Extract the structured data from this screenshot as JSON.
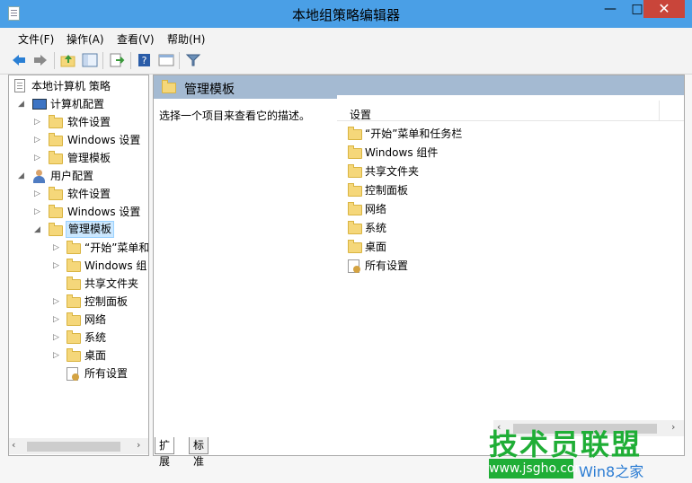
{
  "window": {
    "title": "本地组策略编辑器",
    "min_label": "—",
    "max_label": "□",
    "close_label": "✕"
  },
  "menu": [
    "文件(F)",
    "操作(A)",
    "查看(V)",
    "帮助(H)"
  ],
  "toolbar": {
    "icons": [
      "back-arrow-icon",
      "forward-arrow-icon",
      "up-folder-icon",
      "show-hide-tree-icon",
      "export-list-icon",
      "help-icon",
      "properties-icon",
      "filter-icon"
    ]
  },
  "tree": {
    "root": "本地计算机 策略",
    "computer_config": "计算机配置",
    "cc_children": [
      "软件设置",
      "Windows 设置",
      "管理模板"
    ],
    "user_config": "用户配置",
    "uc_children": [
      "软件设置",
      "Windows 设置"
    ],
    "admin_templates": "管理模板",
    "at_children": [
      "“开始”菜单和",
      "Windows 组",
      "共享文件夹",
      "控制面板",
      "网络",
      "系统",
      "桌面",
      "所有设置"
    ]
  },
  "right": {
    "header_title": "管理模板",
    "description": "选择一个项目来查看它的描述。",
    "column_header": "设置",
    "items": [
      "“开始”菜单和任务栏",
      "Windows 组件",
      "共享文件夹",
      "控制面板",
      "网络",
      "系统",
      "桌面",
      "所有设置"
    ]
  },
  "tabs": [
    "扩展",
    "标准"
  ],
  "watermark": {
    "brand": "技术员联盟",
    "url": "www.jsgho.com",
    "tail": "Win8之家"
  },
  "colors": {
    "titlebar": "#4a9fe6",
    "close_button": "#c9453a",
    "header_band": "#a4bad2",
    "selection": "#cce8ff",
    "watermark_green": "#1fae36"
  }
}
